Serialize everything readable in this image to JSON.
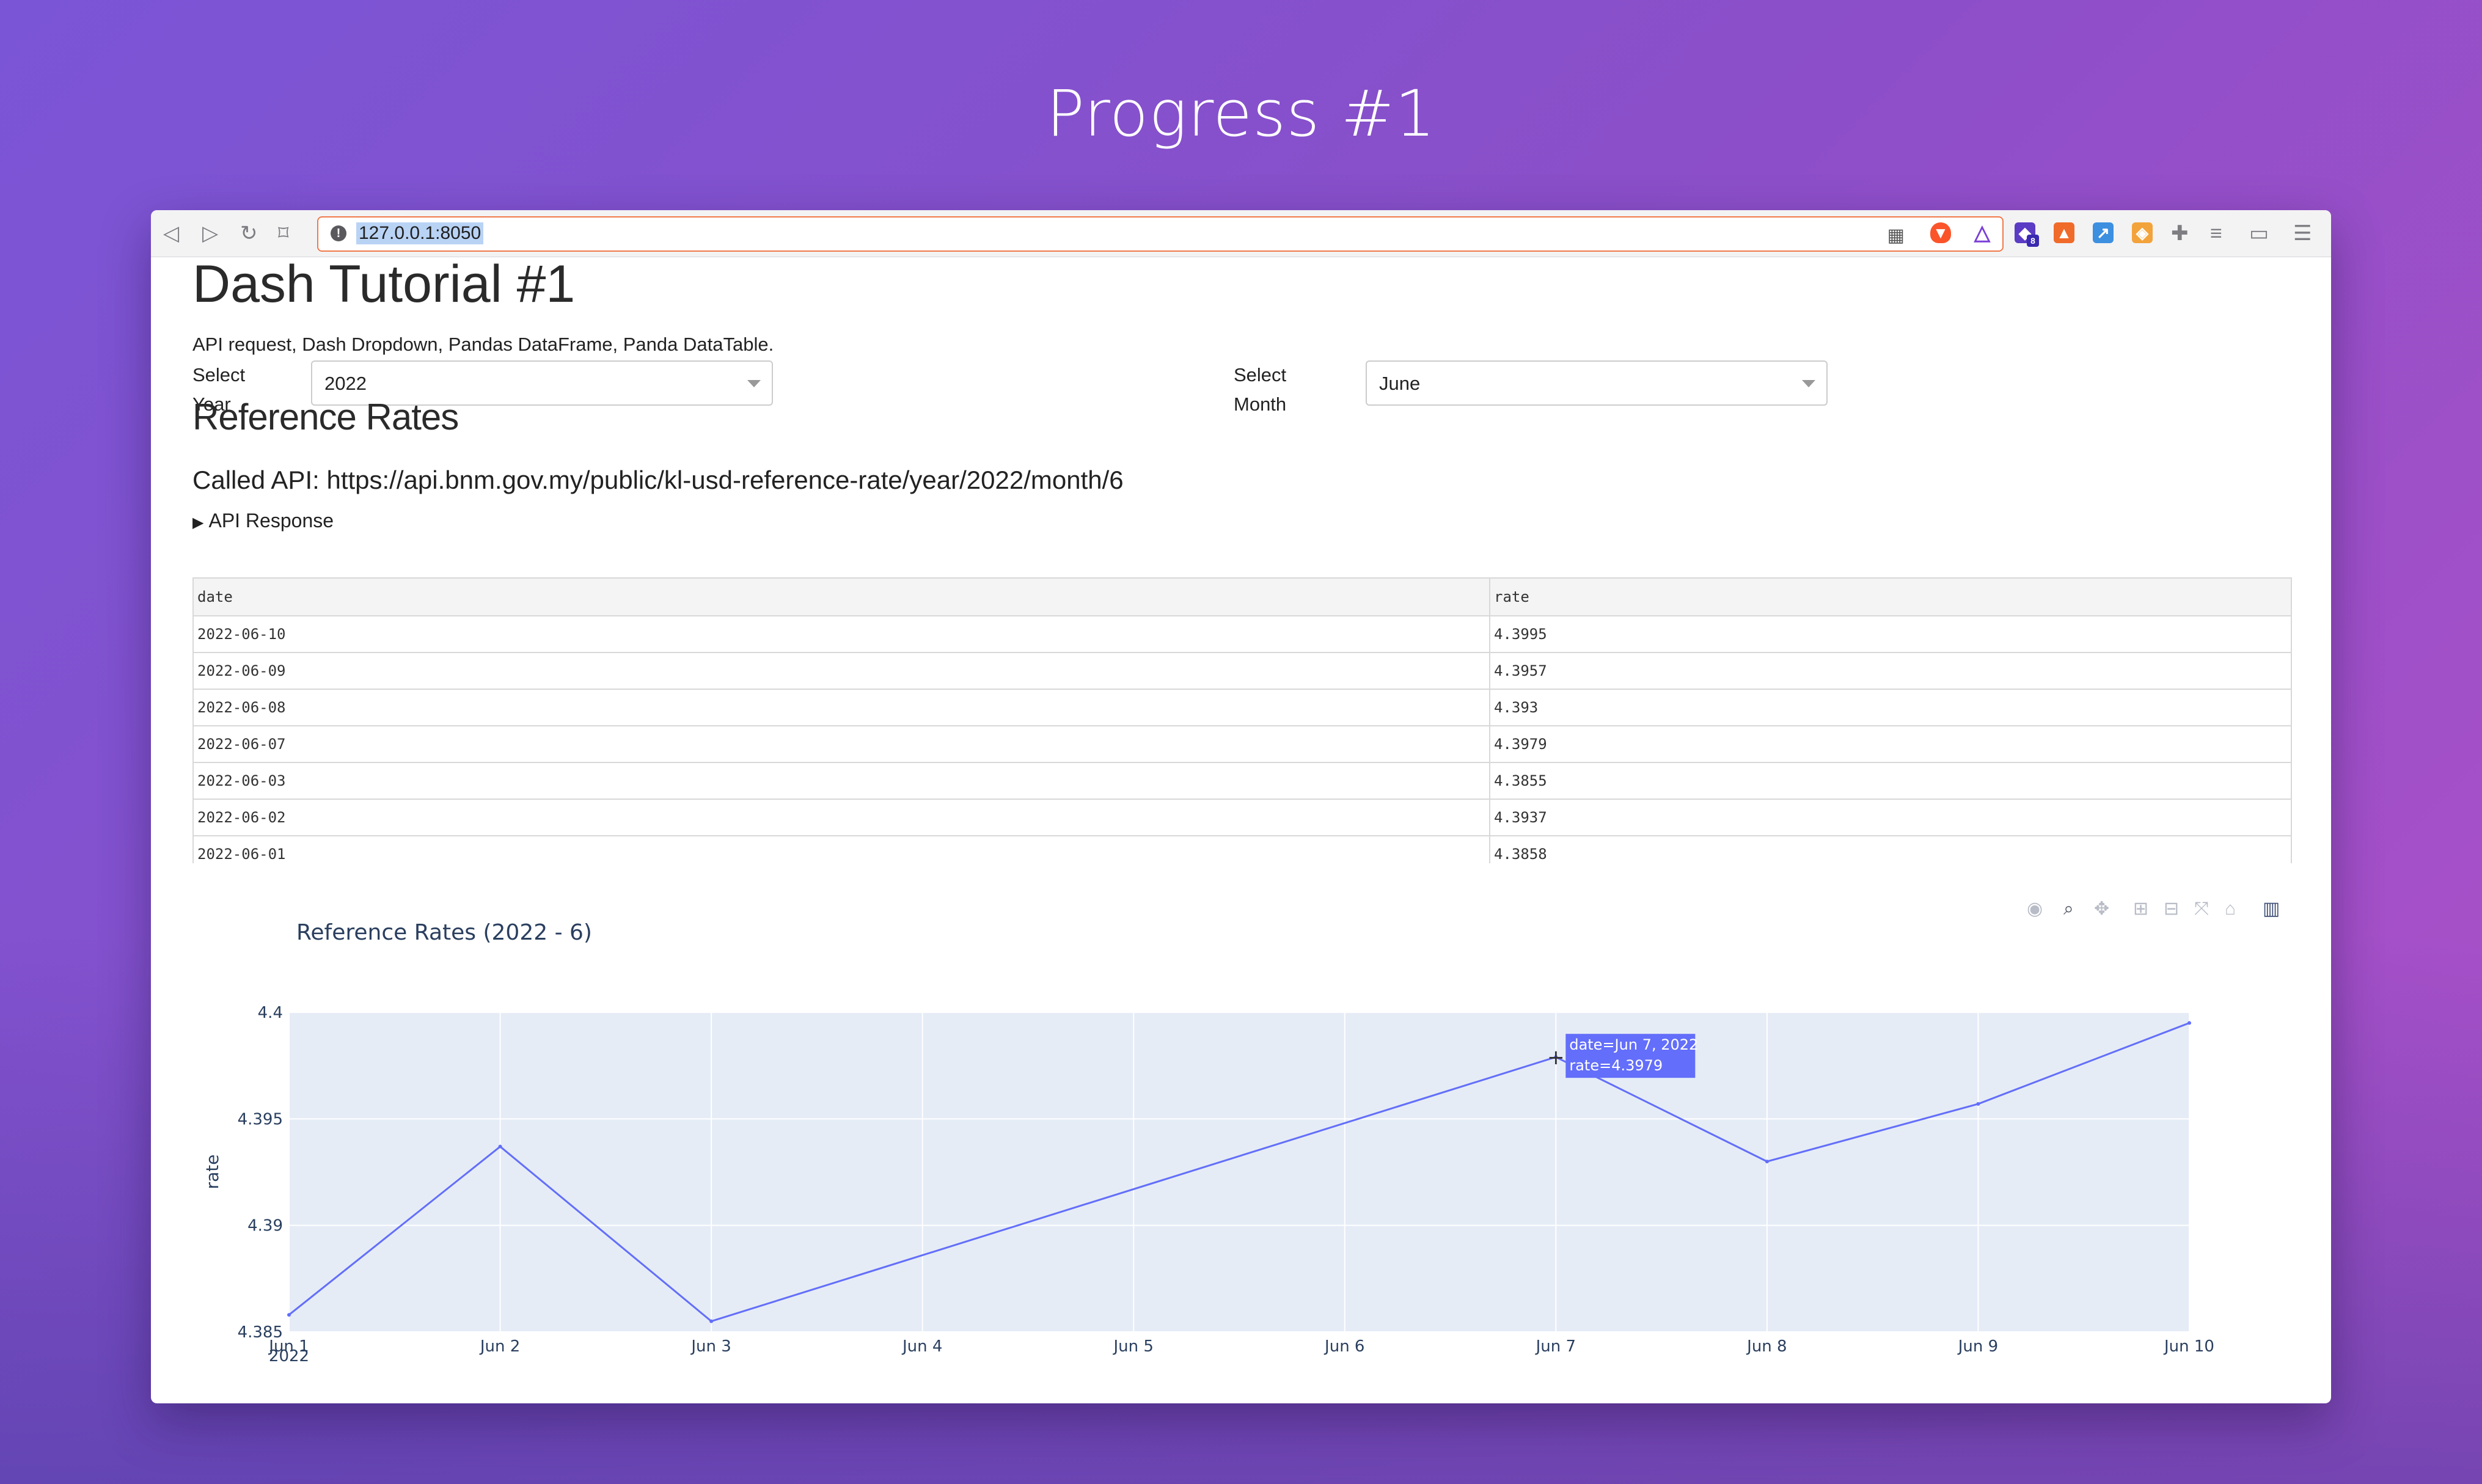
{
  "heading": "Progress #1",
  "browser": {
    "url": "127.0.0.1:8050",
    "info_icon": "info-icon",
    "icons": [
      "back-icon",
      "forward-icon",
      "reload-icon",
      "bookmark-icon",
      "qr-icon",
      "brave-shield-icon",
      "brave-rewards-icon",
      "extension-icon",
      "menu-icon"
    ],
    "extension_badge": "8"
  },
  "page": {
    "title": "Dash Tutorial #1",
    "subtitle": "API request, Dash Dropdown, Pandas DataFrame, Panda DataTable.",
    "year_label_line1": "Select",
    "year_label_line2": "Year",
    "year_value": "2022",
    "month_label_line1": "Select",
    "month_label_line2": "Month",
    "month_value": "June",
    "section_title": "Reference Rates",
    "api_called": "Called API: https://api.bnm.gov.my/public/kl-usd-reference-rate/year/2022/month/6",
    "api_response": "API Response"
  },
  "table": {
    "columns": [
      "date",
      "rate"
    ],
    "rows": [
      [
        "2022-06-10",
        "4.3995"
      ],
      [
        "2022-06-09",
        "4.3957"
      ],
      [
        "2022-06-08",
        "4.393"
      ],
      [
        "2022-06-07",
        "4.3979"
      ],
      [
        "2022-06-03",
        "4.3855"
      ],
      [
        "2022-06-02",
        "4.3937"
      ],
      [
        "2022-06-01",
        "4.3858"
      ]
    ]
  },
  "chart_data": {
    "type": "line",
    "title": "Reference Rates (2022 - 6)",
    "xlabel": "",
    "ylabel": "rate",
    "x": [
      "Jun 1",
      "Jun 2",
      "Jun 3",
      "Jun 7",
      "Jun 8",
      "Jun 9",
      "Jun 10"
    ],
    "x_day": [
      1,
      2,
      3,
      7,
      8,
      9,
      10
    ],
    "values": [
      4.3858,
      4.3937,
      4.3855,
      4.3979,
      4.393,
      4.3957,
      4.3995
    ],
    "x_ticks": [
      "Jun 1",
      "Jun 2",
      "Jun 3",
      "Jun 4",
      "Jun 5",
      "Jun 6",
      "Jun 7",
      "Jun 8",
      "Jun 9",
      "Jun 10"
    ],
    "x_tick_year": "2022",
    "y_ticks": [
      "4.385",
      "4.39",
      "4.395",
      "4.4"
    ],
    "ylim": [
      4.385,
      4.4
    ],
    "grid": true,
    "line_color": "#636efa",
    "plot_bg": "#e5ecf6",
    "hover": {
      "line1": "date=Jun 7, 2022",
      "line2": "rate=4.3979",
      "point_index": 3
    }
  },
  "modebar_icons": [
    "camera-icon",
    "zoom-icon",
    "pan-icon",
    "zoom-in-icon",
    "zoom-out-icon",
    "autoscale-icon",
    "reset-axes-icon",
    "plotly-logo-icon"
  ],
  "fab": {
    "label": "<>"
  }
}
